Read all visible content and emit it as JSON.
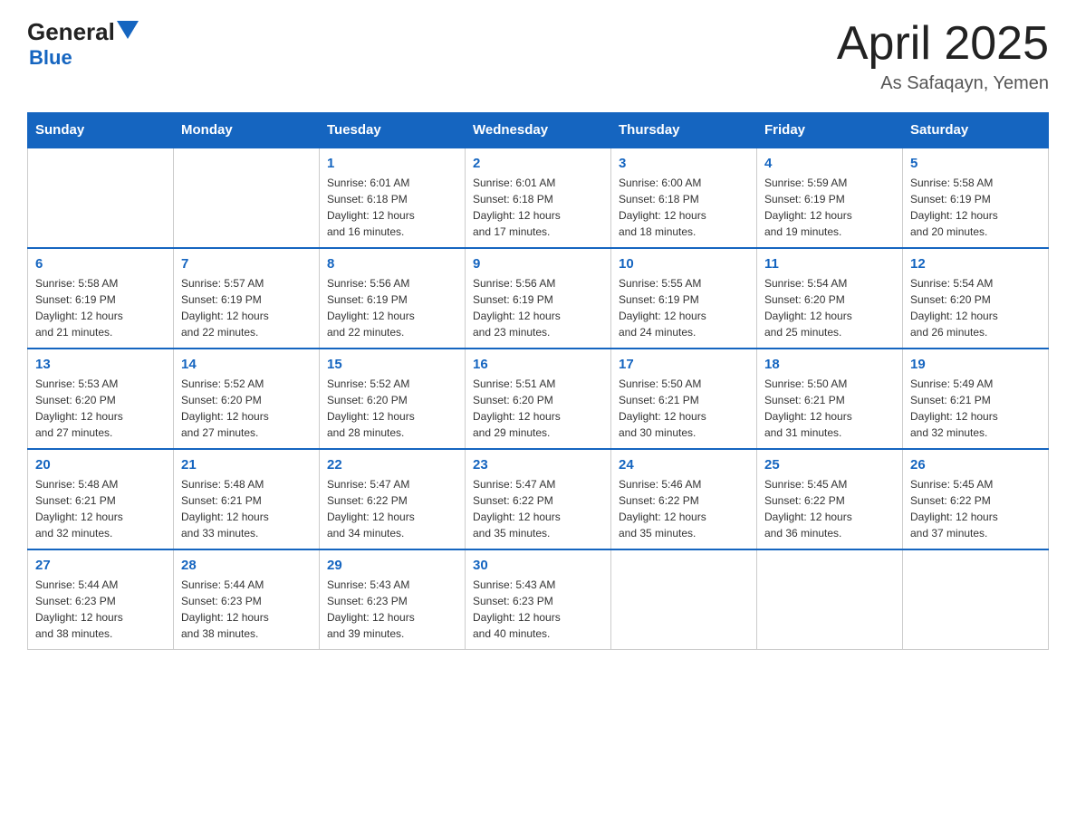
{
  "header": {
    "logo_general": "General",
    "logo_blue": "Blue",
    "title": "April 2025",
    "subtitle": "As Safaqayn, Yemen"
  },
  "calendar": {
    "days_of_week": [
      "Sunday",
      "Monday",
      "Tuesday",
      "Wednesday",
      "Thursday",
      "Friday",
      "Saturday"
    ],
    "weeks": [
      [
        {
          "day": "",
          "info": ""
        },
        {
          "day": "",
          "info": ""
        },
        {
          "day": "1",
          "info": "Sunrise: 6:01 AM\nSunset: 6:18 PM\nDaylight: 12 hours\nand 16 minutes."
        },
        {
          "day": "2",
          "info": "Sunrise: 6:01 AM\nSunset: 6:18 PM\nDaylight: 12 hours\nand 17 minutes."
        },
        {
          "day": "3",
          "info": "Sunrise: 6:00 AM\nSunset: 6:18 PM\nDaylight: 12 hours\nand 18 minutes."
        },
        {
          "day": "4",
          "info": "Sunrise: 5:59 AM\nSunset: 6:19 PM\nDaylight: 12 hours\nand 19 minutes."
        },
        {
          "day": "5",
          "info": "Sunrise: 5:58 AM\nSunset: 6:19 PM\nDaylight: 12 hours\nand 20 minutes."
        }
      ],
      [
        {
          "day": "6",
          "info": "Sunrise: 5:58 AM\nSunset: 6:19 PM\nDaylight: 12 hours\nand 21 minutes."
        },
        {
          "day": "7",
          "info": "Sunrise: 5:57 AM\nSunset: 6:19 PM\nDaylight: 12 hours\nand 22 minutes."
        },
        {
          "day": "8",
          "info": "Sunrise: 5:56 AM\nSunset: 6:19 PM\nDaylight: 12 hours\nand 22 minutes."
        },
        {
          "day": "9",
          "info": "Sunrise: 5:56 AM\nSunset: 6:19 PM\nDaylight: 12 hours\nand 23 minutes."
        },
        {
          "day": "10",
          "info": "Sunrise: 5:55 AM\nSunset: 6:19 PM\nDaylight: 12 hours\nand 24 minutes."
        },
        {
          "day": "11",
          "info": "Sunrise: 5:54 AM\nSunset: 6:20 PM\nDaylight: 12 hours\nand 25 minutes."
        },
        {
          "day": "12",
          "info": "Sunrise: 5:54 AM\nSunset: 6:20 PM\nDaylight: 12 hours\nand 26 minutes."
        }
      ],
      [
        {
          "day": "13",
          "info": "Sunrise: 5:53 AM\nSunset: 6:20 PM\nDaylight: 12 hours\nand 27 minutes."
        },
        {
          "day": "14",
          "info": "Sunrise: 5:52 AM\nSunset: 6:20 PM\nDaylight: 12 hours\nand 27 minutes."
        },
        {
          "day": "15",
          "info": "Sunrise: 5:52 AM\nSunset: 6:20 PM\nDaylight: 12 hours\nand 28 minutes."
        },
        {
          "day": "16",
          "info": "Sunrise: 5:51 AM\nSunset: 6:20 PM\nDaylight: 12 hours\nand 29 minutes."
        },
        {
          "day": "17",
          "info": "Sunrise: 5:50 AM\nSunset: 6:21 PM\nDaylight: 12 hours\nand 30 minutes."
        },
        {
          "day": "18",
          "info": "Sunrise: 5:50 AM\nSunset: 6:21 PM\nDaylight: 12 hours\nand 31 minutes."
        },
        {
          "day": "19",
          "info": "Sunrise: 5:49 AM\nSunset: 6:21 PM\nDaylight: 12 hours\nand 32 minutes."
        }
      ],
      [
        {
          "day": "20",
          "info": "Sunrise: 5:48 AM\nSunset: 6:21 PM\nDaylight: 12 hours\nand 32 minutes."
        },
        {
          "day": "21",
          "info": "Sunrise: 5:48 AM\nSunset: 6:21 PM\nDaylight: 12 hours\nand 33 minutes."
        },
        {
          "day": "22",
          "info": "Sunrise: 5:47 AM\nSunset: 6:22 PM\nDaylight: 12 hours\nand 34 minutes."
        },
        {
          "day": "23",
          "info": "Sunrise: 5:47 AM\nSunset: 6:22 PM\nDaylight: 12 hours\nand 35 minutes."
        },
        {
          "day": "24",
          "info": "Sunrise: 5:46 AM\nSunset: 6:22 PM\nDaylight: 12 hours\nand 35 minutes."
        },
        {
          "day": "25",
          "info": "Sunrise: 5:45 AM\nSunset: 6:22 PM\nDaylight: 12 hours\nand 36 minutes."
        },
        {
          "day": "26",
          "info": "Sunrise: 5:45 AM\nSunset: 6:22 PM\nDaylight: 12 hours\nand 37 minutes."
        }
      ],
      [
        {
          "day": "27",
          "info": "Sunrise: 5:44 AM\nSunset: 6:23 PM\nDaylight: 12 hours\nand 38 minutes."
        },
        {
          "day": "28",
          "info": "Sunrise: 5:44 AM\nSunset: 6:23 PM\nDaylight: 12 hours\nand 38 minutes."
        },
        {
          "day": "29",
          "info": "Sunrise: 5:43 AM\nSunset: 6:23 PM\nDaylight: 12 hours\nand 39 minutes."
        },
        {
          "day": "30",
          "info": "Sunrise: 5:43 AM\nSunset: 6:23 PM\nDaylight: 12 hours\nand 40 minutes."
        },
        {
          "day": "",
          "info": ""
        },
        {
          "day": "",
          "info": ""
        },
        {
          "day": "",
          "info": ""
        }
      ]
    ]
  }
}
